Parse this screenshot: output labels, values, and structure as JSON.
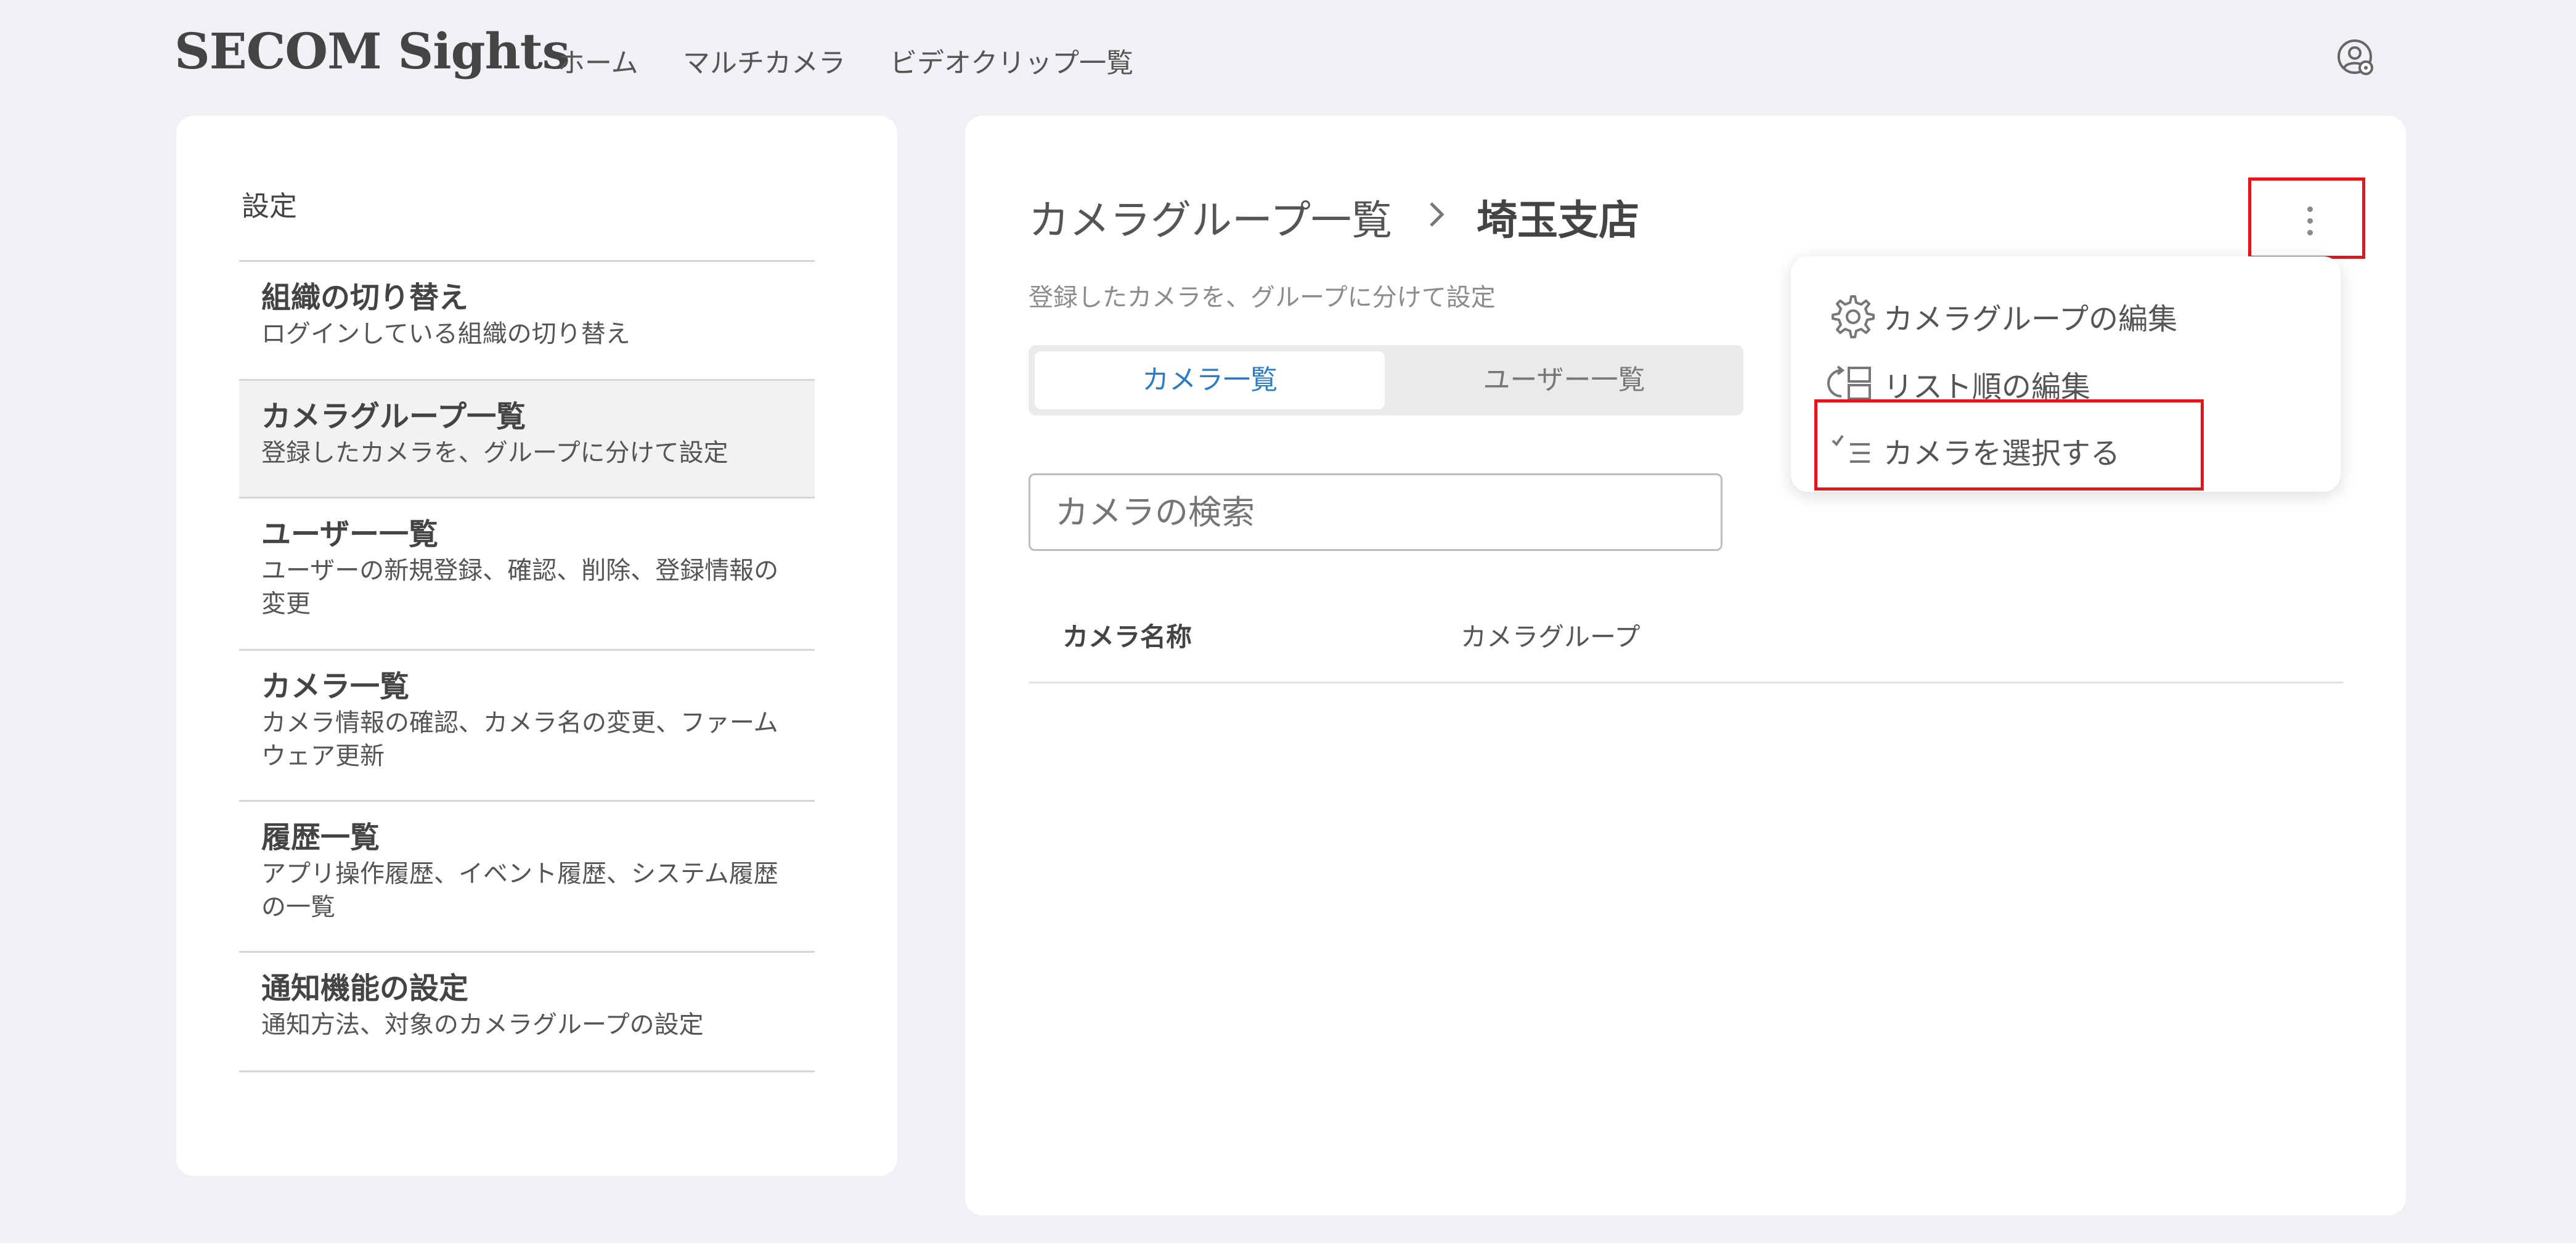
{
  "header": {
    "logo": "SECOM Sights",
    "nav": [
      "ホーム",
      "マルチカメラ",
      "ビデオクリップ一覧"
    ],
    "account_icon": "user-settings-icon"
  },
  "sidebar": {
    "title": "設定",
    "items": [
      {
        "title": "組織の切り替え",
        "desc": "ログインしている組織の切り替え"
      },
      {
        "title": "カメラグループ一覧",
        "desc": "登録したカメラを、グループに分けて設定",
        "active": true
      },
      {
        "title": "ユーザー一覧",
        "desc": "ユーザーの新規登録、確認、削除、登録情報の変更"
      },
      {
        "title": "カメラ一覧",
        "desc": "カメラ情報の確認、カメラ名の変更、ファームウェア更新"
      },
      {
        "title": "履歴一覧",
        "desc": "アプリ操作履歴、イベント履歴、システム履歴の一覧"
      },
      {
        "title": "通知機能の設定",
        "desc": "通知方法、対象のカメラグループの設定"
      }
    ]
  },
  "main": {
    "breadcrumb_parent": "カメラグループ一覧",
    "breadcrumb_current": "埼玉支店",
    "subtitle": "登録したカメラを、グループに分けて設定",
    "tabs": [
      "カメラ一覧",
      "ユーザー一覧"
    ],
    "active_tab": "カメラ一覧",
    "search_placeholder": "カメラの検索",
    "table_headers": [
      "カメラ名称",
      "カメラグループ"
    ]
  },
  "dropdown": {
    "items": [
      {
        "label": "カメラグループの編集",
        "icon": "gear-icon"
      },
      {
        "label": "リスト順の編集",
        "icon": "reorder-icon"
      },
      {
        "label": "カメラを選択する",
        "icon": "checklist-icon"
      }
    ]
  },
  "colors": {
    "background": "#f0f1f5",
    "accent": "#2b7cc9",
    "highlight": "#e8141c"
  }
}
